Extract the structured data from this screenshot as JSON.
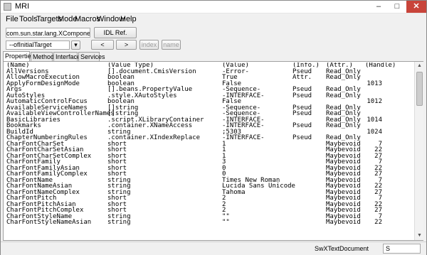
{
  "window": {
    "title": "MRI",
    "minimize": "–",
    "maximize": "□",
    "close": "✕"
  },
  "menu": [
    "File",
    "Tools",
    "Targets",
    "Mode",
    "Macros",
    "Window",
    "Help"
  ],
  "toolbar": {
    "target_value": "com.sun.star.lang.XComponent",
    "idl_ref_label": "IDL Ref.",
    "name_value": "--ofInitialTarget",
    "dropdown_arrow": "▾",
    "back_label": "<",
    "forward_label": ">",
    "index_label": "index",
    "name_label": "name"
  },
  "tabs": [
    "Properties",
    "Methods",
    "Interfaces",
    "Services"
  ],
  "table": {
    "header": [
      "(Name)",
      "(Value Type)",
      "(Value)",
      "(Info.)",
      "(Attr.)",
      "(Handle)"
    ],
    "rows": [
      [
        "AllVersions",
        "[].document.CmisVersion",
        "-Error-",
        "Pseud",
        "Read_Only",
        ""
      ],
      [
        "AllowMacroExecution",
        "boolean",
        "True",
        "Attr.",
        "Read_Only",
        ""
      ],
      [
        "ApplyFormDesignMode",
        "boolean",
        "False",
        "",
        "",
        "1013"
      ],
      [
        "Args",
        "[].beans.PropertyValue",
        "-Sequence-",
        "Pseud",
        "Read_Only",
        ""
      ],
      [
        "AutoStyles",
        ".style.XAutoStyles",
        "-INTERFACE-",
        "Pseud",
        "Read_Only",
        ""
      ],
      [
        "AutomaticControlFocus",
        "boolean",
        "False",
        "",
        "",
        "1012"
      ],
      [
        "AvailableServiceNames",
        "[]string",
        "-Sequence-",
        "Pseud",
        "Read_Only",
        ""
      ],
      [
        "AvailableViewControllerNames",
        "[]string",
        "-Sequence-",
        "Pseud",
        "Read_Only",
        ""
      ],
      [
        "BasicLibraries",
        ".script.XLibraryContainer",
        "-INTERFACE-",
        "",
        "Read_Only",
        "1014"
      ],
      [
        "Bookmarks",
        ".container.XNameAccess",
        "-INTERFACE-",
        "Pseud",
        "Read_Only",
        ""
      ],
      [
        "BuildId",
        "string",
        ";5303",
        "",
        "",
        "1024"
      ],
      [
        "ChapterNumberingRules",
        ".container.XIndexReplace",
        "-INTERFACE-",
        "Pseud",
        "Read_Only",
        ""
      ],
      [
        "CharFontCharSet",
        "short",
        "1",
        "",
        "Maybevoid",
        "7"
      ],
      [
        "CharFontCharSetAsian",
        "short",
        "1",
        "",
        "Maybevoid",
        "22"
      ],
      [
        "CharFontCharSetComplex",
        "short",
        "1",
        "",
        "Maybevoid",
        "27"
      ],
      [
        "CharFontFamily",
        "short",
        "3",
        "",
        "Maybevoid",
        "7"
      ],
      [
        "CharFontFamilyAsian",
        "short",
        "0",
        "",
        "Maybevoid",
        "22"
      ],
      [
        "CharFontFamilyComplex",
        "short",
        "0",
        "",
        "Maybevoid",
        "27"
      ],
      [
        "CharFontName",
        "string",
        "Times New Roman",
        "",
        "Maybevoid",
        "7"
      ],
      [
        "CharFontNameAsian",
        "string",
        "Lucida Sans Unicode",
        "",
        "Maybevoid",
        "22"
      ],
      [
        "CharFontNameComplex",
        "string",
        "Tahoma",
        "",
        "Maybevoid",
        "27"
      ],
      [
        "CharFontPitch",
        "short",
        "2",
        "",
        "Maybevoid",
        "7"
      ],
      [
        "CharFontPitchAsian",
        "short",
        "2",
        "",
        "Maybevoid",
        "22"
      ],
      [
        "CharFontPitchComplex",
        "short",
        "2",
        "",
        "Maybevoid",
        "27"
      ],
      [
        "CharFontStyleName",
        "string",
        "\"\"",
        "",
        "Maybevoid",
        "7"
      ],
      [
        "CharFontStyleNameAsian",
        "string",
        "\"\"",
        "",
        "Maybevoid",
        "22"
      ]
    ]
  },
  "scrollbar": {
    "up": "▲",
    "down": "▼"
  },
  "status": {
    "type": "SwXTextDocument",
    "field": "S"
  }
}
